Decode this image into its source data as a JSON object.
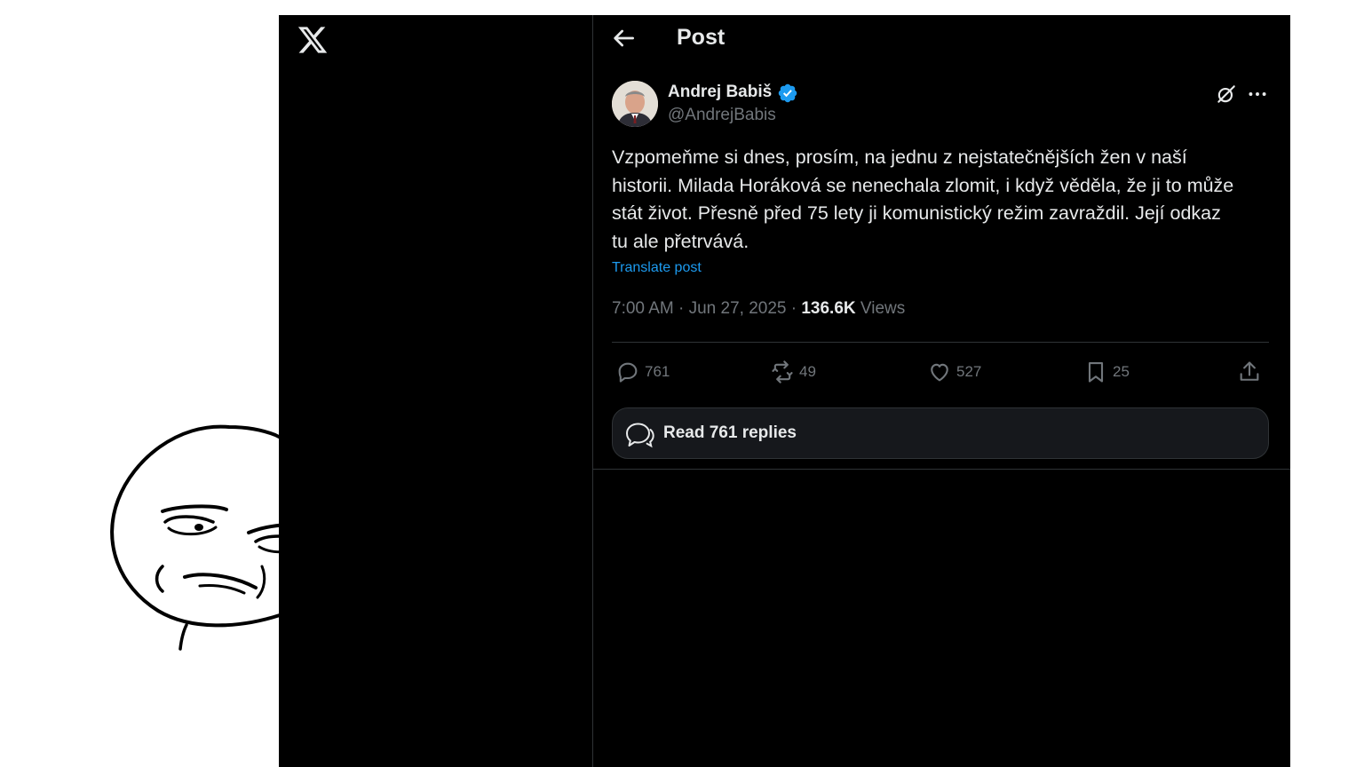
{
  "header": {
    "title": "Post"
  },
  "author": {
    "name": "Andrej Babiš",
    "handle": "@AndrejBabis"
  },
  "post": {
    "lines": [
      "Vzpomeňme si dnes, prosím, na jednu z nejstatečnějších žen v naší",
      "historii. Milada Horáková se nenechala zlomit, i když věděla, že ji to může",
      "stát život. Přesně před 75 lety ji komunistický režim zavraždil. Její odkaz",
      "tu ale přetrvává."
    ],
    "translate_label": "Translate post",
    "timestamp": "7:00 AM · Jun 27, 2025 · ",
    "views_count": "136.6K",
    "views_label": " Views"
  },
  "actions": {
    "replies": "761",
    "reposts": "49",
    "likes": "527",
    "bookmarks": "25"
  },
  "read_replies_label": "Read 761 replies",
  "colors": {
    "background": "#000000",
    "text": "#e7e9ea",
    "muted": "#71767b",
    "link": "#1d9bf0",
    "verified": "#1d9bf0",
    "border": "#2f3336"
  },
  "icons": [
    "x-logo",
    "back-arrow-icon",
    "verified-badge-icon",
    "grok-icon",
    "more-icon",
    "reply-icon",
    "repost-icon",
    "like-icon",
    "bookmark-icon",
    "share-icon",
    "replies-bubble-icon"
  ]
}
